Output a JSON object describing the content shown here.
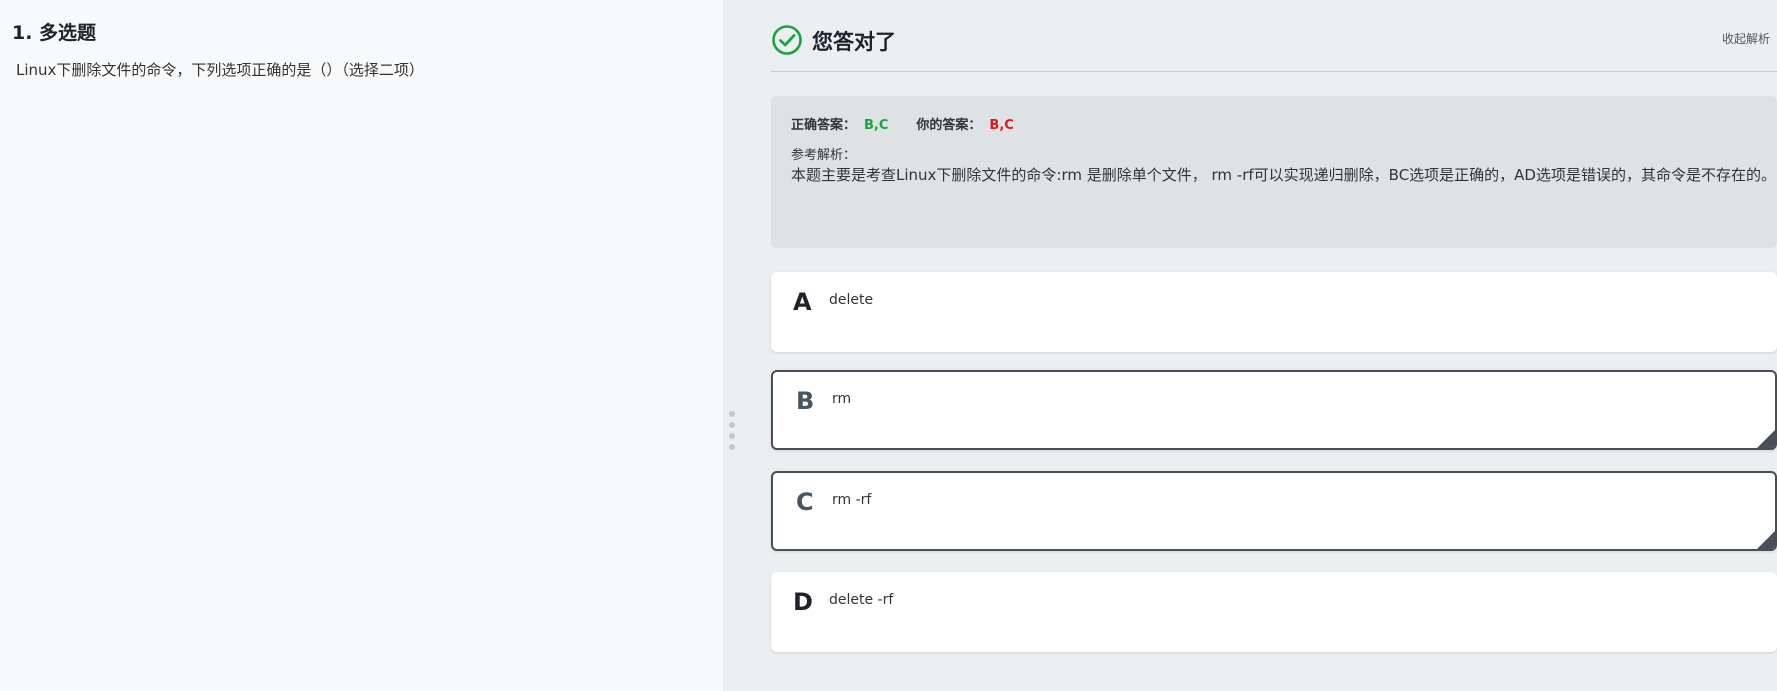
{
  "question": {
    "title": "1. 多选题",
    "text": "Linux下删除文件的命令，下列选项正确的是（）（选择二项）"
  },
  "result": {
    "status_text": "您答对了",
    "collapse_label": "收起解析",
    "icon": "check-circle-icon",
    "status_color": "#1aa33c"
  },
  "analysis": {
    "correct_label": "正确答案：",
    "correct_value": "B,C",
    "your_label": "你的答案：",
    "your_value": "B,C",
    "explain_label": "参考解析：",
    "explain_text": "本题主要是考查Linux下删除文件的命令:rm 是删除单个文件， rm  -rf可以实现递归删除，BC选项是正确的，AD选项是错误的，其命令是不存在的。"
  },
  "options": [
    {
      "letter": "A",
      "text": "delete",
      "selected": false
    },
    {
      "letter": "B",
      "text": "rm",
      "selected": true
    },
    {
      "letter": "C",
      "text": "rm  -rf",
      "selected": true
    },
    {
      "letter": "D",
      "text": "delete  -rf",
      "selected": false
    }
  ]
}
